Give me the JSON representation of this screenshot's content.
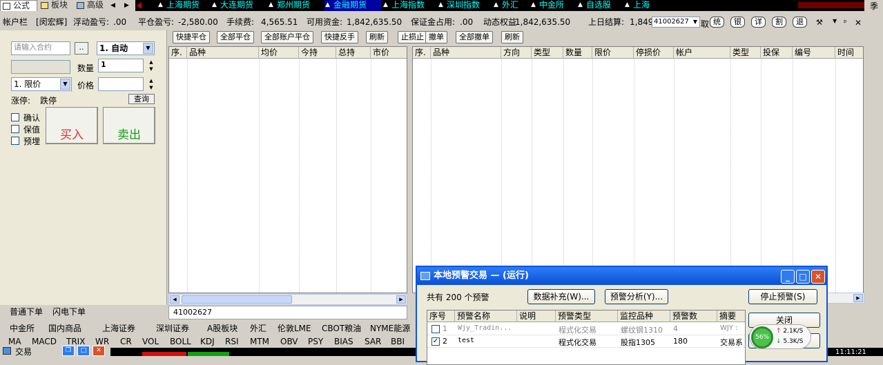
{
  "top_tabs": [
    {
      "label": "公式"
    },
    {
      "label": "板块"
    },
    {
      "label": "高级"
    }
  ],
  "ticker": [
    "上海期货",
    "大连期货",
    "郑州期货",
    "金融期货",
    "上海指数",
    "深圳指数",
    "外汇",
    "中金所",
    "自选股",
    "上海"
  ],
  "ticker_selected": 3,
  "season_char": "季",
  "account_bar": {
    "account": "帐户栏",
    "user": "[闵宏辉]",
    "float_pl_label": "浮动盈亏:",
    "float_pl": ".00",
    "close_pl_label": "平仓盈亏:",
    "close_pl": "-2,580.00",
    "fee_label": "手续费:",
    "fee": "4,565.51",
    "avail_label": "可用资金:",
    "avail": "1,842,635.50",
    "margin_label": "保证金占用:",
    "margin": ".00",
    "equity_label": "动态权益:",
    "equity": "1,842,635.50",
    "settle_label": "上日结算:",
    "settle": "1,849",
    "account_id": "41002627",
    "take_label": "取",
    "round_buttons": [
      "统",
      "银",
      "详",
      "割",
      "退"
    ]
  },
  "order_panel": {
    "contract_placeholder": "请输入合约",
    "browse": "..",
    "mode": "1. 自动",
    "qty_label": "数量",
    "qty": "1",
    "price_type": "1. 限价",
    "price_label": "价格",
    "limit_label": "涨停:",
    "limit_down": "跌停",
    "query_btn": "查询",
    "check_confirm": "确认",
    "check_protect": "保值",
    "check_preset": "预埋",
    "buy": "买入",
    "sell": "卖出",
    "tab_normal": "普通下单",
    "tab_flash": "闪电下单"
  },
  "toolbar": [
    "快捷平仓",
    "全部平仓",
    "全部账户平仓",
    "快捷反手",
    "刷新",
    "止损止",
    "撤单",
    "全部撤单",
    "刷新"
  ],
  "position_grid": {
    "headers": [
      "序.",
      "品种",
      "均价",
      "今持",
      "总持",
      "市价"
    ],
    "footer_account": "41002627"
  },
  "order_grid": {
    "headers": [
      "序.",
      "品种",
      "方向",
      "类型",
      "数量",
      "限价",
      "停损价",
      "帐户",
      "类型",
      "投保",
      "编号",
      "时间"
    ]
  },
  "categories": [
    "中金所",
    "国内商品",
    "上海证券",
    "深圳证券",
    "A股板块",
    "外汇",
    "伦敦LME",
    "CBOT粮油",
    "NYME能源"
  ],
  "indicators": [
    "MA",
    "MACD",
    "TRIX",
    "WR",
    "CR",
    "VOL",
    "BOLL",
    "KDJ",
    "RSI",
    "MTM",
    "OBV",
    "PSY",
    "BIAS",
    "SAR",
    "BBI"
  ],
  "task_trade": "交易",
  "dialog": {
    "title": "本地预警交易 — (运行)",
    "count_text": "共有  200  个预警",
    "btn_supplement": "数据补充(W)...",
    "btn_analysis": "预警分析(Y)...",
    "btn_stop": "停止预警(S)",
    "btn_close": "关闭",
    "headers": [
      "序号",
      "预警名称",
      "说明",
      "预警类型",
      "监控品种",
      "预警数",
      "摘要"
    ],
    "rows": [
      {
        "checked": false,
        "idx": "1",
        "name": "Wjy_Tradin...",
        "desc": "",
        "type": "程式化交易",
        "symbol": "螺纹钢1310",
        "count": "4",
        "summary": "WJY :"
      },
      {
        "checked": true,
        "idx": "2",
        "name": "test",
        "desc": "",
        "type": "程式化交易",
        "symbol": "股指1305",
        "count": "180",
        "summary": "交易系"
      }
    ]
  },
  "net": {
    "percent": "56%",
    "up": "2.1K/S",
    "down": "5.3K/S"
  },
  "clock": "11:11:21"
}
